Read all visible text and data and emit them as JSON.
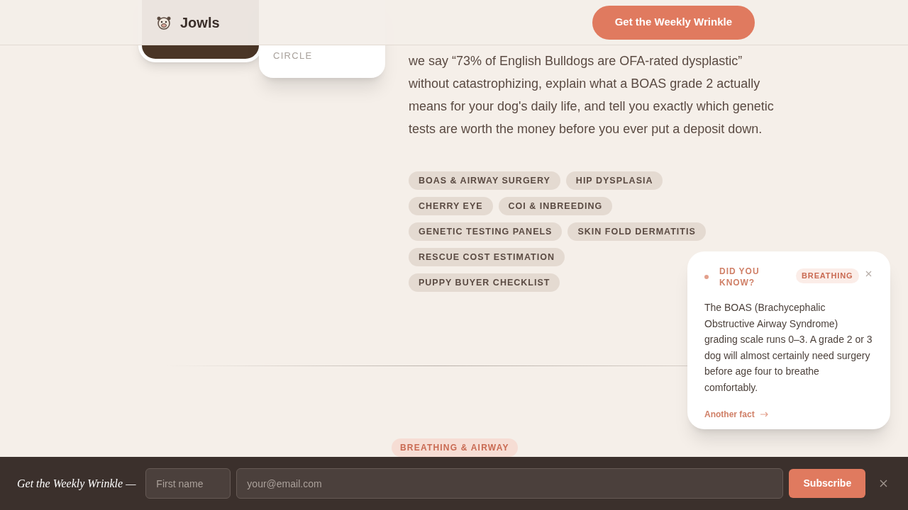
{
  "header": {
    "brand": "Jowls",
    "cta": "Get the Weekly Wrinkle"
  },
  "profile_card": {
    "label": "CIRCLE"
  },
  "intro": "we say “73% of English Bulldogs are OFA-rated dysplastic” without catastrophizing, explain what a BOAS grade 2 actually means for your dog's daily life, and tell you exactly which genetic tests are worth the money before you ever put a deposit down.",
  "topics": [
    "BOAS & AIRWAY SURGERY",
    "HIP DYSPLASIA",
    "CHERRY EYE",
    "COI & INBREEDING",
    "GENETIC TESTING PANELS",
    "SKIN FOLD DERMATITIS",
    "RESCUE COST ESTIMATION",
    "PUPPY BUYER CHECKLIST"
  ],
  "section_tag": "BREATHING & AIRWAY",
  "fact_popup": {
    "heading": "DID YOU KNOW?",
    "tag": "BREATHING",
    "text": "The BOAS (Brachycephalic Obstructive Airway Syndrome) grading scale runs 0–3. A grade 2 or 3 dog will almost certainly need surgery before age four to breathe comfortably.",
    "link": "Another fact"
  },
  "newsletter_bar": {
    "title": "Get the Weekly Wrinkle —",
    "first_name": {
      "placeholder": "First name"
    },
    "email": {
      "placeholder": "your@email.com"
    },
    "button": "Subscribe"
  }
}
